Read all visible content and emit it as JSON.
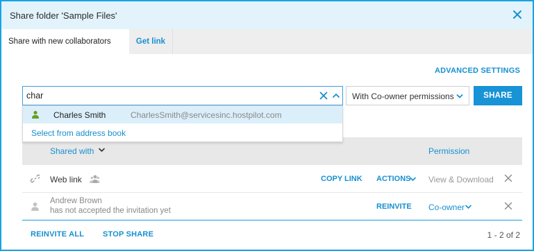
{
  "dialog": {
    "title": "Share folder 'Sample Files'",
    "close_icon": "close-icon"
  },
  "tabs": [
    {
      "label": "Share with new collaborators",
      "active": true
    },
    {
      "label": "Get link",
      "active": false
    }
  ],
  "advanced_settings_label": "ADVANCED SETTINGS",
  "search": {
    "value": "char",
    "placeholder": ""
  },
  "suggestions": [
    {
      "name": "Charles Smith",
      "email": "CharlesSmith@servicesinc.hostpilot.com",
      "icon": "user-icon"
    }
  ],
  "address_book_label": "Select from address book",
  "permission_select": {
    "selected": "With Co-owner permissions"
  },
  "share_button_label": "SHARE",
  "table": {
    "col_shared_with": "Shared with",
    "col_permission": "Permission",
    "rows": [
      {
        "name": "Web link",
        "icon": "link-icon",
        "copy_link_label": "COPY LINK",
        "actions_label": "ACTIONS",
        "permission": "View & Download"
      },
      {
        "name": "Andrew Brown",
        "status": "has not accepted the invitation yet",
        "icon": "user-icon",
        "reinvite_label": "REINVITE",
        "permission": "Co-owner"
      }
    ]
  },
  "footer": {
    "reinvite_all_label": "REINVITE ALL",
    "stop_share_label": "STOP SHARE",
    "pagination": "1 - 2 of 2"
  },
  "colors": {
    "accent": "#1793d6",
    "title_bg": "#e2f3fc",
    "suggestion_bg": "#dbeffb",
    "user_green": "#6a9e1f"
  }
}
